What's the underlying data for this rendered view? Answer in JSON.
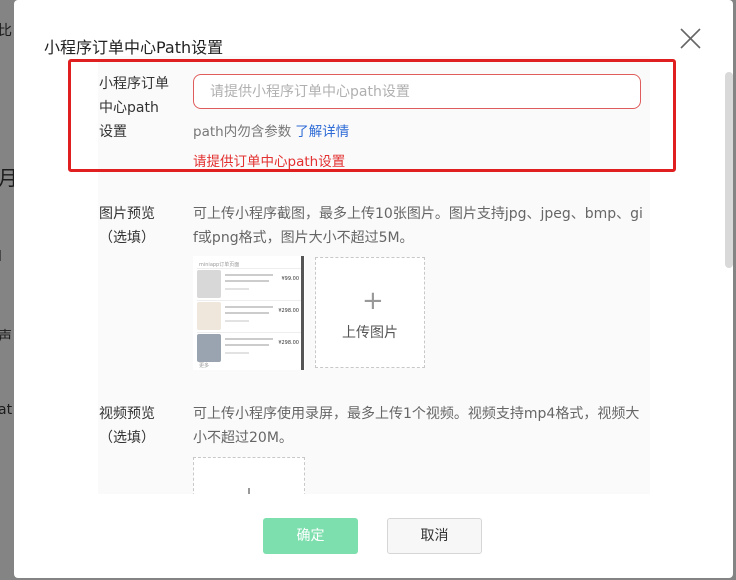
{
  "background": {
    "fragments": [
      "比",
      "月",
      "l",
      "声",
      "at"
    ]
  },
  "modal": {
    "title": "小程序订单中心Path设置",
    "close_icon": "close-icon"
  },
  "path_setting": {
    "label_lines": [
      "小程序订单",
      "中心path",
      "设置"
    ],
    "placeholder": "请提供小程序订单中心path设置",
    "value": "",
    "hint_text": "path内勿含参数",
    "hint_link": "了解详情",
    "error_text": "请提供订单中心path设置",
    "error_color": "#e33030"
  },
  "image_preview": {
    "label_lines": [
      "图片预览",
      "（选填）"
    ],
    "desc_lines": [
      "可上传小程序截图，最多上传10张图片。图片支持jpg、jpeg、bmp、gi",
      "f或png格式，图片大小不超过5M。"
    ],
    "thumbnail": {
      "header": "miniapp订单页面",
      "prices": [
        "¥99.00",
        "¥298.00",
        "¥298.00"
      ],
      "footer": "更多"
    },
    "upload_label": "上传图片",
    "upload_icon": "plus-icon"
  },
  "video_preview": {
    "label_lines": [
      "视频预览",
      "（选填）"
    ],
    "desc_lines": [
      "可上传小程序使用录屏，最多上传1个视频。视频支持mp4格式，视频大",
      "小不超过20M。"
    ],
    "upload_icon": "plus-icon"
  },
  "footer": {
    "confirm_label": "确定",
    "cancel_label": "取消",
    "confirm_color": "#7ddfae"
  }
}
